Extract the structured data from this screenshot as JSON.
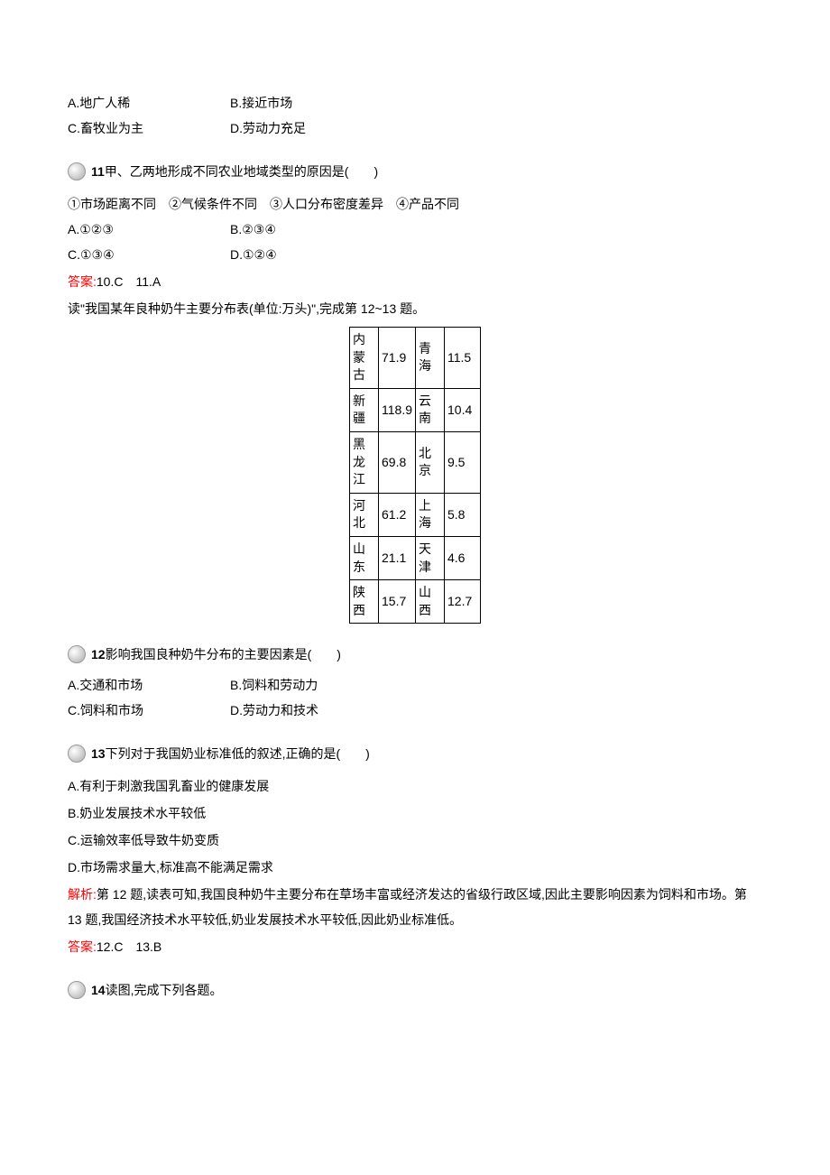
{
  "top_options": {
    "a": "A.地广人稀",
    "b": "B.接近市场",
    "c": "C.畜牧业为主",
    "d": "D.劳动力充足"
  },
  "q11": {
    "num": "11",
    "text": " 甲、乙两地形成不同农业地域类型的原因是(　　)",
    "choices_line": "①市场距离不同　②气候条件不同　③人口分布密度差异　④产品不同",
    "a": "A.①②③",
    "b": "B.②③④",
    "c": "C.①③④",
    "d": "D.①②④"
  },
  "ans10_11": {
    "label": "答案:",
    "text": "10.C　11.A"
  },
  "table_intro": "读\"我国某年良种奶牛主要分布表(单位:万头)\",完成第 12~13 题。",
  "chart_data": {
    "type": "table",
    "rows": [
      {
        "region1": "内蒙古",
        "val1": "71.9",
        "region2": "青海",
        "val2": "11.5"
      },
      {
        "region1": "新疆",
        "val1": "118.9",
        "region2": "云南",
        "val2": "10.4"
      },
      {
        "region1": "黑龙江",
        "val1": "69.8",
        "region2": "北京",
        "val2": "9.5"
      },
      {
        "region1": "河北",
        "val1": "61.2",
        "region2": "上海",
        "val2": "5.8"
      },
      {
        "region1": "山东",
        "val1": "21.1",
        "region2": "天津",
        "val2": "4.6"
      },
      {
        "region1": "陕西",
        "val1": "15.7",
        "region2": "山西",
        "val2": "12.7"
      }
    ]
  },
  "q12": {
    "num": "12",
    "text": " 影响我国良种奶牛分布的主要因素是(　　)",
    "a": "A.交通和市场",
    "b": "B.饲料和劳动力",
    "c": "C.饲料和市场",
    "d": "D.劳动力和技术"
  },
  "q13": {
    "num": "13",
    "text": " 下列对于我国奶业标准低的叙述,正确的是(　　)",
    "a": "A.有利于刺激我国乳畜业的健康发展",
    "b": "B.奶业发展技术水平较低",
    "c": "C.运输效率低导致牛奶变质",
    "d": "D.市场需求量大,标准高不能满足需求"
  },
  "analysis": {
    "label": "解析:",
    "text": "第 12 题,读表可知,我国良种奶牛主要分布在草场丰富或经济发达的省级行政区域,因此主要影响因素为饲料和市场。第 13 题,我国经济技术水平较低,奶业发展技术水平较低,因此奶业标准低。"
  },
  "ans12_13": {
    "label": "答案:",
    "text": "12.C　13.B"
  },
  "q14": {
    "num": "14",
    "text": " 读图,完成下列各题。"
  }
}
